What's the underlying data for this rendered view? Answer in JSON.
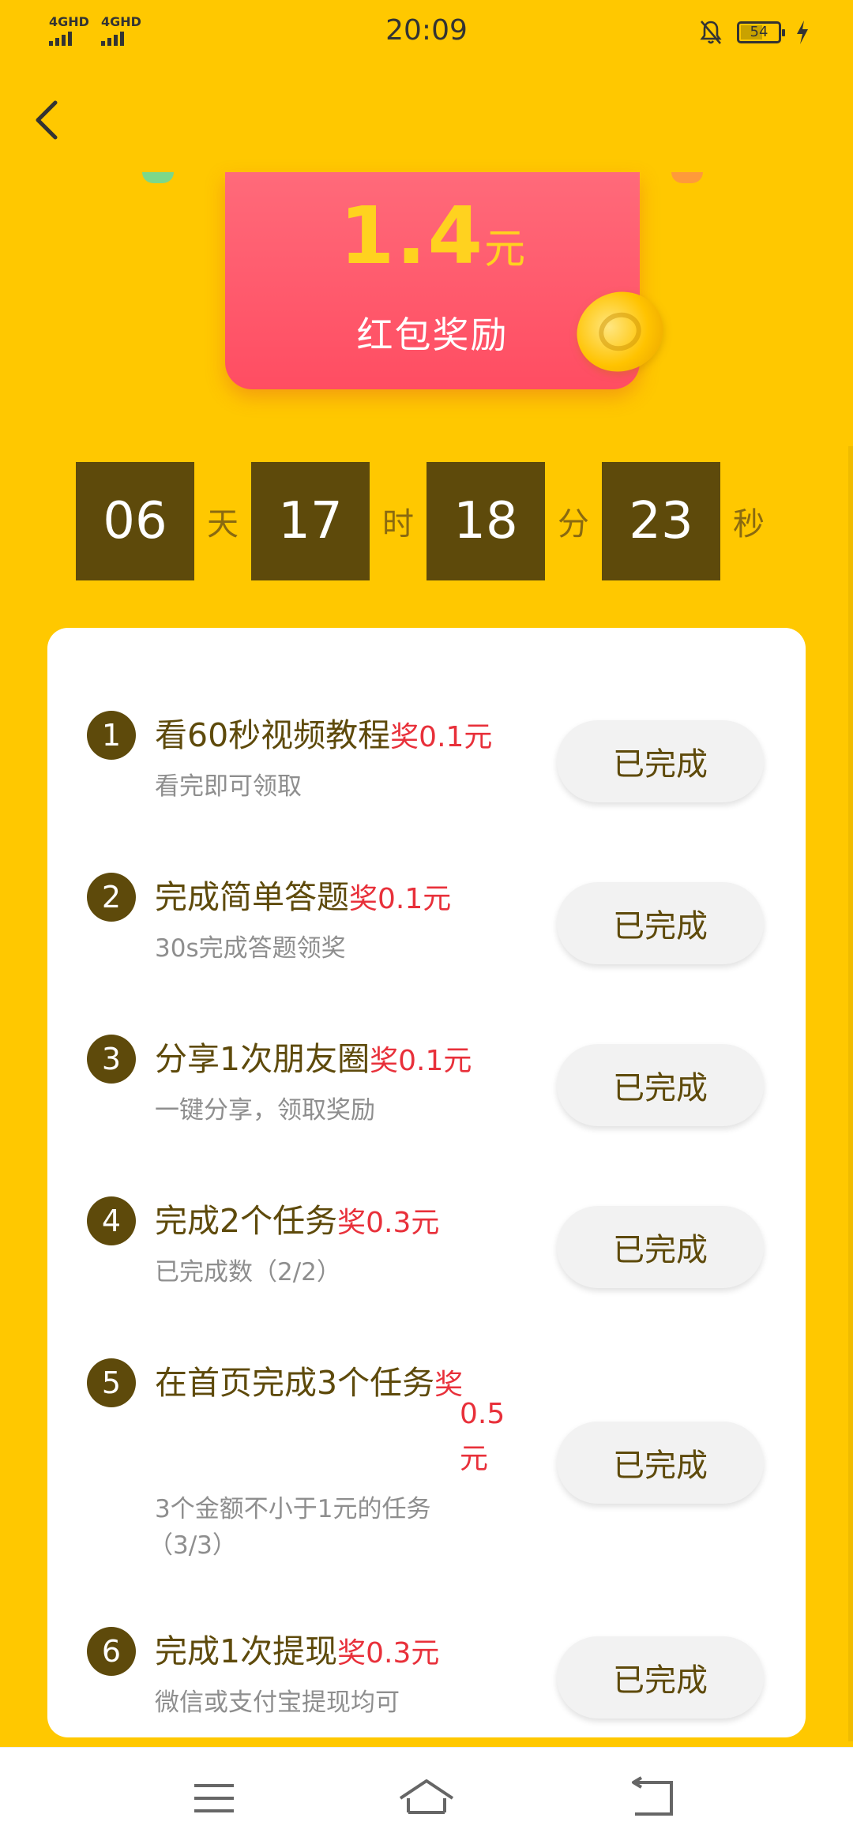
{
  "status_bar": {
    "network_1": "4GHD",
    "network_2": "4GHD",
    "time": "20:09",
    "battery": "54"
  },
  "reward_card": {
    "amount": "1.4",
    "unit": "元",
    "label": "红包奖励"
  },
  "countdown": {
    "days": "06",
    "days_unit": "天",
    "hours": "17",
    "hours_unit": "时",
    "minutes": "18",
    "minutes_unit": "分",
    "seconds": "23",
    "seconds_unit": "秒"
  },
  "tasks": [
    {
      "num": "1",
      "title": "看60秒视频教程",
      "reward": "奖0.1元",
      "sub": "看完即可领取",
      "button": "已完成"
    },
    {
      "num": "2",
      "title": "完成简单答题",
      "reward": "奖0.1元",
      "sub": "30s完成答题领奖",
      "button": "已完成"
    },
    {
      "num": "3",
      "title": "分享1次朋友圈",
      "reward": "奖0.1元",
      "sub": "一键分享，领取奖励",
      "button": "已完成"
    },
    {
      "num": "4",
      "title": "完成2个任务",
      "reward": "奖0.3元",
      "sub": "已完成数（2/2）",
      "button": "已完成"
    },
    {
      "num": "5",
      "title": "在首页完成3个任务",
      "reward_1": "奖",
      "reward_2": "0.5",
      "reward_3": "元",
      "sub_1": "3个金额不小于1元的任务",
      "sub_2": "（3/3）",
      "button": "已完成"
    },
    {
      "num": "6",
      "title": "完成1次提现",
      "reward": "奖0.3元",
      "sub": "微信或支付宝提现均可",
      "button": "已完成"
    }
  ],
  "colors": {
    "background": "#FFC800",
    "dark_brown": "#5E4A0B",
    "reward_red": "#E8303A",
    "envelope_red": "#FF4D62",
    "gold": "#FFD21F"
  },
  "icons": {
    "back": "chevron-left-icon",
    "nav_menu": "menu-icon",
    "nav_home": "home-icon",
    "nav_back": "return-icon"
  }
}
